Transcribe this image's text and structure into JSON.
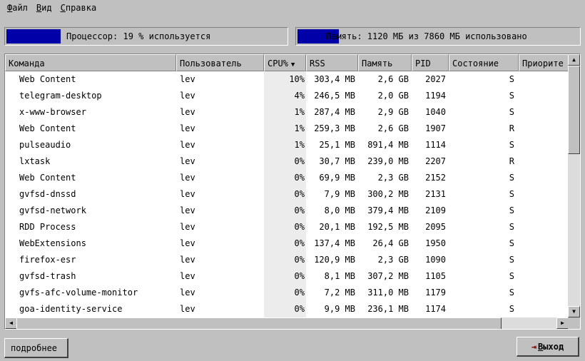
{
  "menu": [
    {
      "key": "Ф",
      "rest": "айл"
    },
    {
      "key": "В",
      "rest": "ид"
    },
    {
      "key": "С",
      "rest": "правка"
    }
  ],
  "cpu": {
    "text": "Процессор: 19 % используется",
    "usage_percent": 19
  },
  "memory": {
    "text": "Память: 1120 МБ из 7860 МБ использовано",
    "used_mb": 1120,
    "total_mb": 7860
  },
  "columns": [
    "Команда",
    "Пользователь",
    "CPU%",
    "RSS",
    "Память",
    "PID",
    "Состояние",
    "Приорите"
  ],
  "sort_column": "CPU%",
  "processes": [
    [
      "Web Content",
      "lev",
      "10%",
      "303,4 MB",
      "2,6 GB",
      "2027",
      "S",
      ""
    ],
    [
      "telegram-desktop",
      "lev",
      "4%",
      "246,5 MB",
      "2,0 GB",
      "1194",
      "S",
      ""
    ],
    [
      "x-www-browser",
      "lev",
      "1%",
      "287,4 MB",
      "2,9 GB",
      "1040",
      "S",
      ""
    ],
    [
      "Web Content",
      "lev",
      "1%",
      "259,3 MB",
      "2,6 GB",
      "1907",
      "R",
      ""
    ],
    [
      "pulseaudio",
      "lev",
      "1%",
      "25,1 MB",
      "891,4 MB",
      "1114",
      "S",
      ""
    ],
    [
      "lxtask",
      "lev",
      "0%",
      "30,7 MB",
      "239,0 MB",
      "2207",
      "R",
      ""
    ],
    [
      "Web Content",
      "lev",
      "0%",
      "69,9 MB",
      "2,3 GB",
      "2152",
      "S",
      ""
    ],
    [
      "gvfsd-dnssd",
      "lev",
      "0%",
      "7,9 MB",
      "300,2 MB",
      "2131",
      "S",
      ""
    ],
    [
      "gvfsd-network",
      "lev",
      "0%",
      "8,0 MB",
      "379,4 MB",
      "2109",
      "S",
      ""
    ],
    [
      "RDD Process",
      "lev",
      "0%",
      "20,1 MB",
      "192,5 MB",
      "2095",
      "S",
      ""
    ],
    [
      "WebExtensions",
      "lev",
      "0%",
      "137,4 MB",
      "26,4 GB",
      "1950",
      "S",
      ""
    ],
    [
      "firefox-esr",
      "lev",
      "0%",
      "120,9 MB",
      "2,3 GB",
      "1090",
      "S",
      ""
    ],
    [
      "gvfsd-trash",
      "lev",
      "0%",
      "8,1 MB",
      "307,2 MB",
      "1105",
      "S",
      ""
    ],
    [
      "gvfs-afc-volume-monitor",
      "lev",
      "0%",
      "7,2 MB",
      "311,0 MB",
      "1179",
      "S",
      ""
    ],
    [
      "goa-identity-service",
      "lev",
      "0%",
      "9,9 MB",
      "236,1 MB",
      "1174",
      "S",
      ""
    ]
  ],
  "buttons": {
    "more": "подробнее",
    "exit_key": "В",
    "exit_rest": "ыход"
  },
  "icons": {
    "sort": "triangle-down-icon",
    "exit": "exit-door-icon"
  }
}
